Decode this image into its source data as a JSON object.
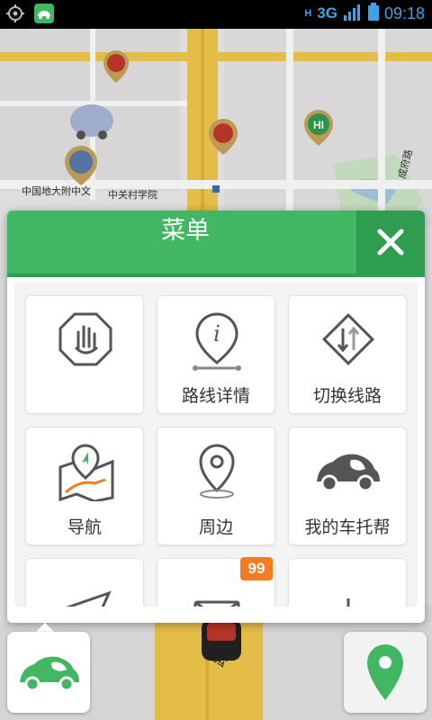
{
  "status_bar": {
    "time": "09:18",
    "network": "3G",
    "signal_h": "H",
    "icons": [
      "gps-icon",
      "app-car-icon",
      "signal-icon",
      "battery-icon"
    ]
  },
  "map": {
    "labels": {
      "poi_a": "中国地大附中文",
      "poi_b": "中关村学院",
      "road_vertical_right": "成府路",
      "road_bottom": "路"
    }
  },
  "menu": {
    "title": "菜单",
    "close_icon": "close-icon",
    "items": [
      {
        "label": "",
        "icon": "stop-hand-icon"
      },
      {
        "label": "路线详情",
        "icon": "route-info-icon"
      },
      {
        "label": "切换线路",
        "icon": "switch-route-icon"
      },
      {
        "label": "导航",
        "icon": "navigation-map-icon"
      },
      {
        "label": "周边",
        "icon": "nearby-pin-icon"
      },
      {
        "label": "我的车托帮",
        "icon": "car-icon"
      },
      {
        "label": "",
        "icon": "send-icon"
      },
      {
        "label": "",
        "icon": "message-icon",
        "badge": "99"
      },
      {
        "label": "",
        "icon": "power-icon"
      }
    ]
  },
  "colors": {
    "accent_green": "#41b763",
    "header_dark_green": "#2e9d4f",
    "badge_orange": "#f47b20",
    "road_yellow": "#f2c94c"
  }
}
